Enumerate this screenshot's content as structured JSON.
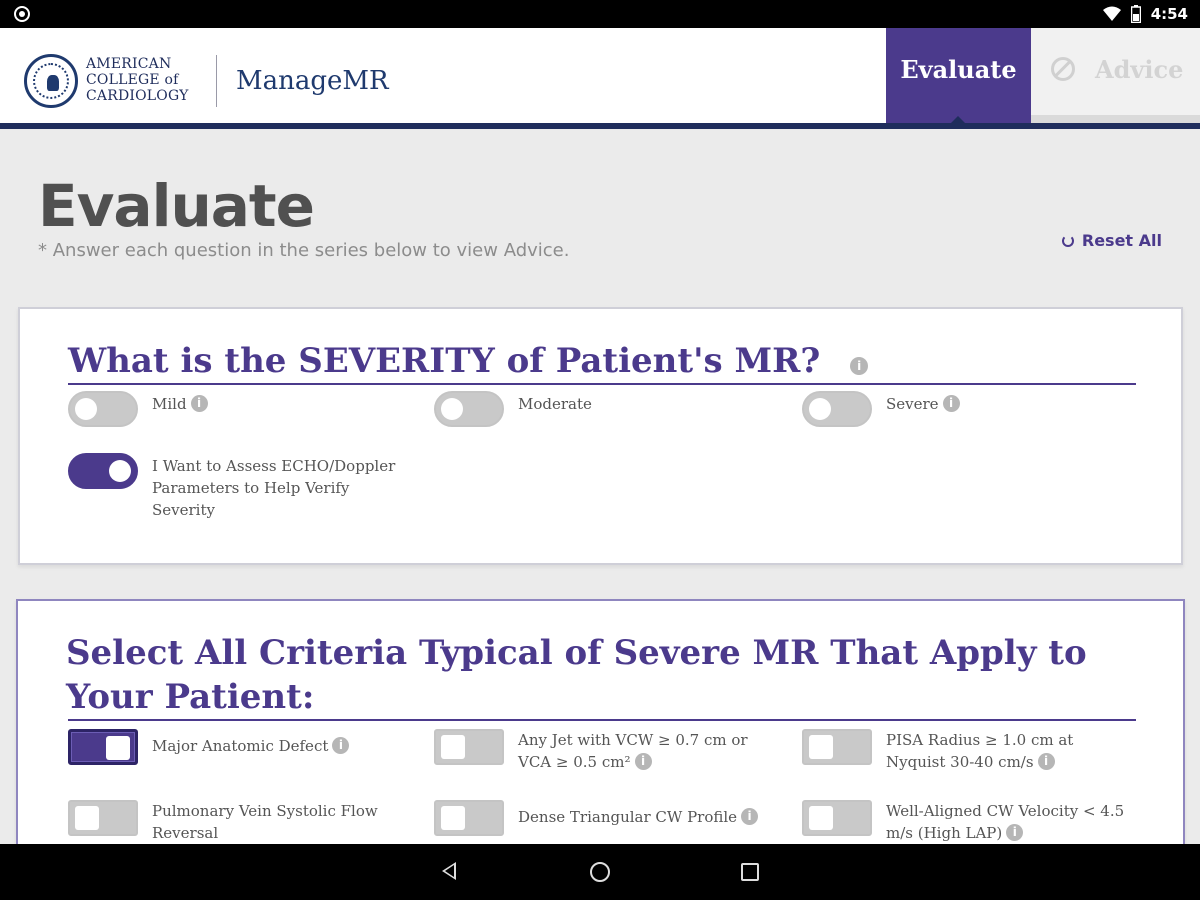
{
  "status_bar": {
    "time": "4:54"
  },
  "header": {
    "org_name_lines": [
      "AMERICAN",
      "COLLEGE of",
      "CARDIOLOGY"
    ],
    "app_name": "ManageMR",
    "tabs": [
      {
        "label": "Evaluate",
        "active": true
      },
      {
        "label": "Advice",
        "active": false,
        "disabled": true
      }
    ]
  },
  "page": {
    "title": "Evaluate",
    "subtitle": "* Answer each question in the series below to view Advice.",
    "reset_label": "Reset All"
  },
  "severity_card": {
    "title": "What is the SEVERITY of Patient's MR?",
    "options": [
      {
        "label": "Mild",
        "checked": false,
        "info": true
      },
      {
        "label": "Moderate",
        "checked": false,
        "info": false
      },
      {
        "label": "Severe",
        "checked": false,
        "info": true
      },
      {
        "label": "I Want to Assess ECHO/Doppler Parameters to Help Verify Severity",
        "checked": true,
        "info": false
      }
    ]
  },
  "criteria_card": {
    "title": "Select All Criteria Typical of Severe MR That Apply to Your Patient:",
    "options": [
      {
        "label": "Major Anatomic Defect",
        "checked": true,
        "info": true
      },
      {
        "label": "Any Jet with VCW ≥ 0.7 cm or VCA ≥ 0.5 cm²",
        "checked": false,
        "info": true
      },
      {
        "label": "PISA Radius ≥ 1.0 cm at Nyquist 30-40 cm/s",
        "checked": false,
        "info": true
      },
      {
        "label": "Pulmonary Vein Systolic Flow Reversal",
        "checked": false,
        "info": false
      },
      {
        "label": "Dense Triangular CW Profile",
        "checked": false,
        "info": true
      },
      {
        "label": "Well-Aligned CW Velocity < 4.5 m/s (High LAP)",
        "checked": false,
        "info": true
      }
    ]
  },
  "colors": {
    "brand_purple": "#4b3a8c",
    "navy": "#1f2d5c",
    "background": "#ebebeb"
  }
}
